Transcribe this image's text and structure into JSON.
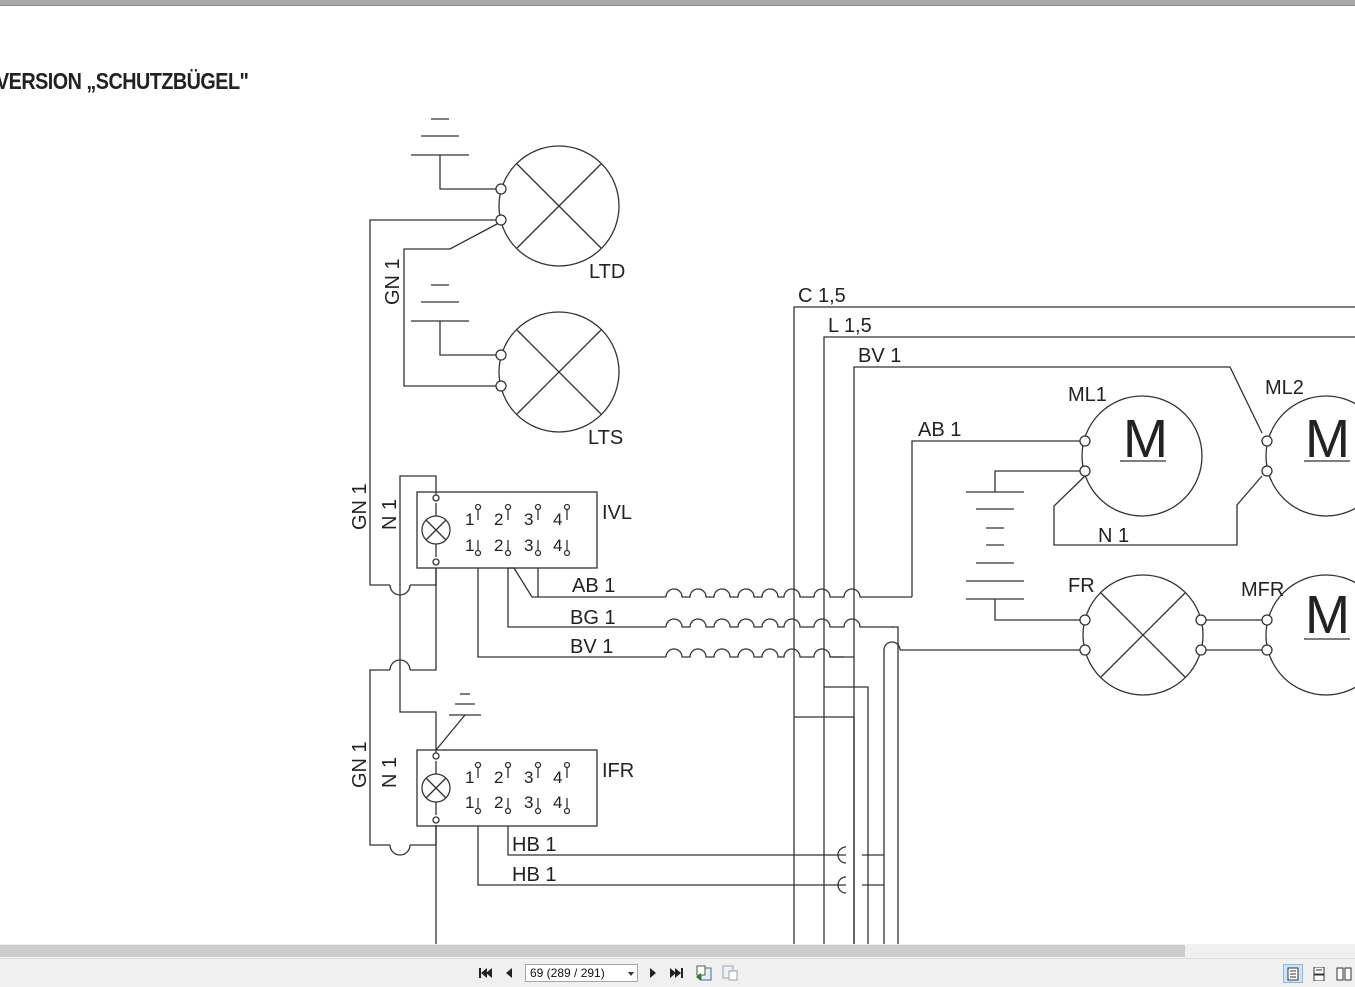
{
  "document": {
    "heading": "VERSION „SCHUTZBÜGEL\"",
    "labels": {
      "ltd": "LTD",
      "lts": "LTS",
      "gn1_top": "GN 1",
      "gn1_mid": "GN 1",
      "gn1_low": "GN 1",
      "n1_mid": "N 1",
      "n1_low": "N 1",
      "n1_motor": "N 1",
      "ivl": "IVL",
      "ifr": "IFR",
      "c15": "C 1,5",
      "l15": "L 1,5",
      "bv1_top": "BV 1",
      "bv1_low": "BV 1",
      "ab1_top": "AB 1",
      "ab1_low": "AB 1",
      "bg1": "BG 1",
      "hb1_a": "HB 1",
      "hb1_b": "HB 1",
      "ml1": "ML1",
      "ml2": "ML2",
      "mfr": "MFR",
      "fr": "FR",
      "motor_symbol": "M"
    },
    "switch_terminals": {
      "top": [
        "1",
        "2",
        "3",
        "4"
      ],
      "bottom": [
        "1",
        "2",
        "3",
        "4"
      ]
    }
  },
  "viewer": {
    "page_select": "69 (289 / 291)",
    "icons": {
      "first": "first-page-icon",
      "prev": "previous-page-icon",
      "next": "next-page-icon",
      "last": "last-page-icon",
      "back": "previous-view-icon",
      "forward": "next-view-icon",
      "single": "single-page-view-icon",
      "continuous": "continuous-view-icon",
      "facing": "facing-pages-view-icon"
    }
  }
}
